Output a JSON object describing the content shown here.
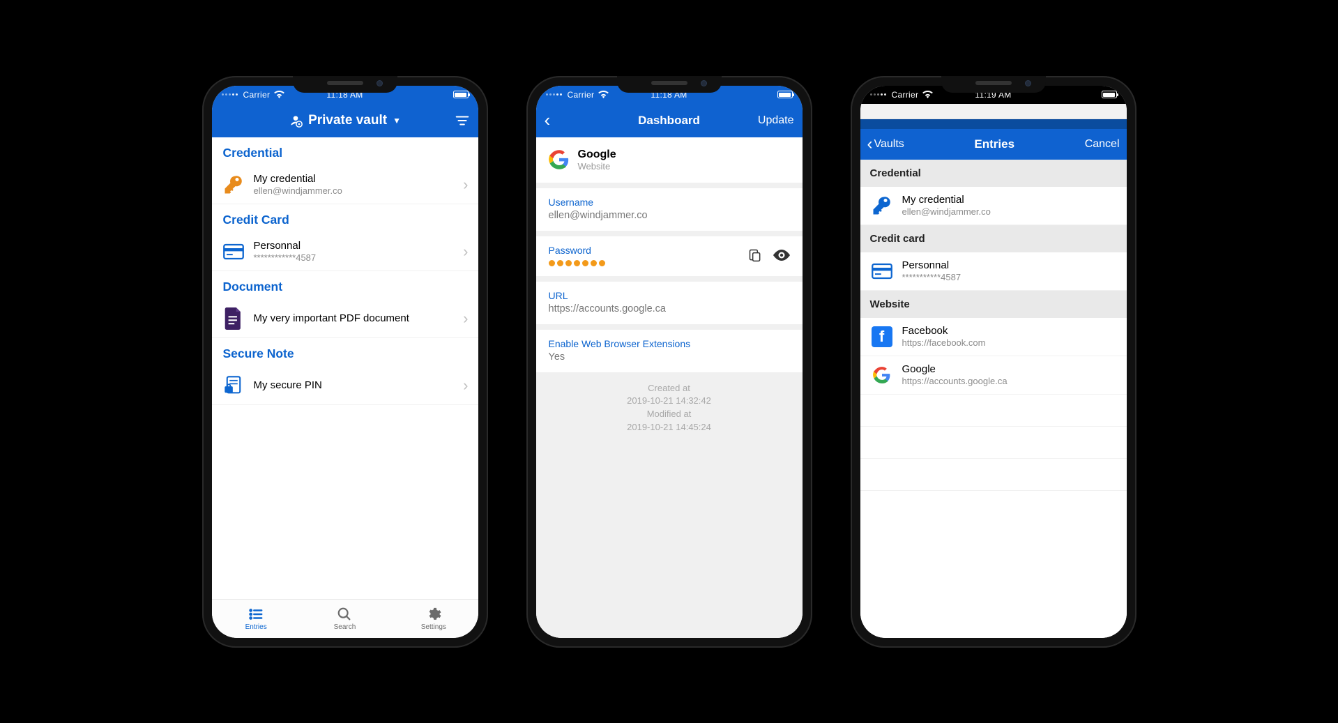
{
  "phone1": {
    "status": {
      "carrier": "Carrier",
      "time": "11:18 AM"
    },
    "nav": {
      "title": "Private vault"
    },
    "sections": [
      {
        "header": "Credential",
        "items": [
          {
            "title": "My credential",
            "subtitle": "ellen@windjammer.co",
            "icon": "key"
          }
        ]
      },
      {
        "header": "Credit Card",
        "items": [
          {
            "title": "Personnal",
            "subtitle": "************4587",
            "icon": "card"
          }
        ]
      },
      {
        "header": "Document",
        "items": [
          {
            "title": "My very important PDF document",
            "subtitle": "",
            "icon": "doc"
          }
        ]
      },
      {
        "header": "Secure Note",
        "items": [
          {
            "title": "My secure PIN",
            "subtitle": "",
            "icon": "note"
          }
        ]
      }
    ],
    "tabs": [
      {
        "label": "Entries",
        "icon": "entries",
        "active": true
      },
      {
        "label": "Search",
        "icon": "search",
        "active": false
      },
      {
        "label": "Settings",
        "icon": "settings",
        "active": false
      }
    ]
  },
  "phone2": {
    "status": {
      "carrier": "Carrier",
      "time": "11:18 AM"
    },
    "nav": {
      "title": "Dashboard",
      "right": "Update"
    },
    "entry": {
      "title": "Google",
      "subtitle": "Website"
    },
    "fields": {
      "username": {
        "label": "Username",
        "value": "ellen@windjammer.co"
      },
      "password": {
        "label": "Password"
      },
      "url": {
        "label": "URL",
        "value": "https://accounts.google.ca"
      },
      "ext": {
        "label": "Enable Web Browser Extensions",
        "value": "Yes"
      }
    },
    "meta": {
      "created_label": "Created at",
      "created_value": "2019-10-21 14:32:42",
      "modified_label": "Modified at",
      "modified_value": "2019-10-21 14:45:24"
    }
  },
  "phone3": {
    "status": {
      "carrier": "Carrier",
      "time": "11:19 AM"
    },
    "nav": {
      "back": "Vaults",
      "title": "Entries",
      "right": "Cancel"
    },
    "sections": [
      {
        "header": "Credential",
        "items": [
          {
            "title": "My credential",
            "subtitle": "ellen@windjammer.co",
            "icon": "key-blue"
          }
        ]
      },
      {
        "header": "Credit card",
        "items": [
          {
            "title": "Personnal",
            "subtitle": "***********4587",
            "icon": "card"
          }
        ]
      },
      {
        "header": "Website",
        "items": [
          {
            "title": "Facebook",
            "subtitle": "https://facebook.com",
            "icon": "fb"
          },
          {
            "title": "Google",
            "subtitle": "https://accounts.google.ca",
            "icon": "google"
          }
        ]
      }
    ]
  }
}
